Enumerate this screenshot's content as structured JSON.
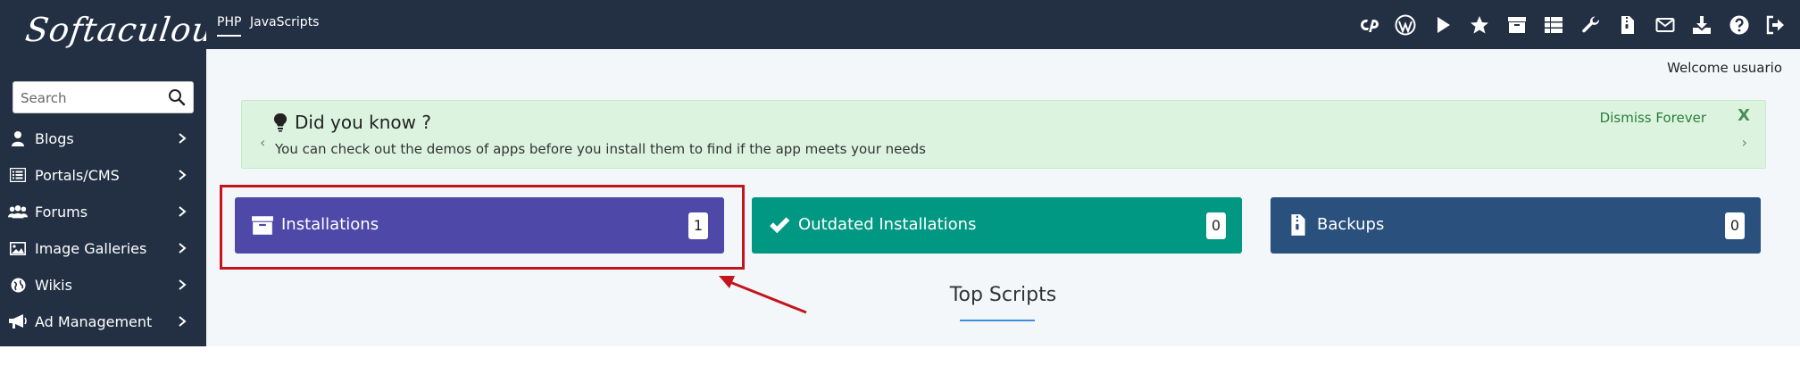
{
  "app": {
    "logo_text": "Softaculous"
  },
  "search": {
    "placeholder": "Search"
  },
  "sidebar": {
    "items": [
      {
        "label": "Blogs",
        "icon": "user-icon"
      },
      {
        "label": "Portals/CMS",
        "icon": "list-icon"
      },
      {
        "label": "Forums",
        "icon": "users-icon"
      },
      {
        "label": "Image Galleries",
        "icon": "image-icon"
      },
      {
        "label": "Wikis",
        "icon": "globe-icon"
      },
      {
        "label": "Ad Management",
        "icon": "megaphone-icon"
      }
    ]
  },
  "topbar": {
    "tabs": [
      {
        "label": "PHP",
        "active": true
      },
      {
        "label": "JavaScripts",
        "active": false
      }
    ],
    "icons": [
      "cpanel-icon",
      "wordpress-icon",
      "play-icon",
      "star-icon",
      "archive-icon",
      "grid-icon",
      "wrench-icon",
      "file-zip-icon",
      "mail-icon",
      "download-icon",
      "help-icon",
      "logout-icon"
    ]
  },
  "welcome": "Welcome usuario",
  "did_you_know": {
    "title": "Did you know ?",
    "text": "You can check out the demos of apps before you install them to find if the app meets your needs",
    "dismiss": "Dismiss Forever",
    "close": "X",
    "prev": "‹",
    "next": "›"
  },
  "cards": [
    {
      "label": "Installations",
      "count": "1",
      "color": "#4e48a9",
      "icon": "archive-icon"
    },
    {
      "label": "Outdated Installations",
      "count": "0",
      "color": "#009882",
      "icon": "check-icon"
    },
    {
      "label": "Backups",
      "count": "0",
      "color": "#2a507d",
      "icon": "file-zip-icon"
    }
  ],
  "section_title": "Top Scripts",
  "colors": {
    "sidebar_bg": "#233044",
    "highlight": "#c6141e",
    "banner_bg": "#dcf4df"
  }
}
